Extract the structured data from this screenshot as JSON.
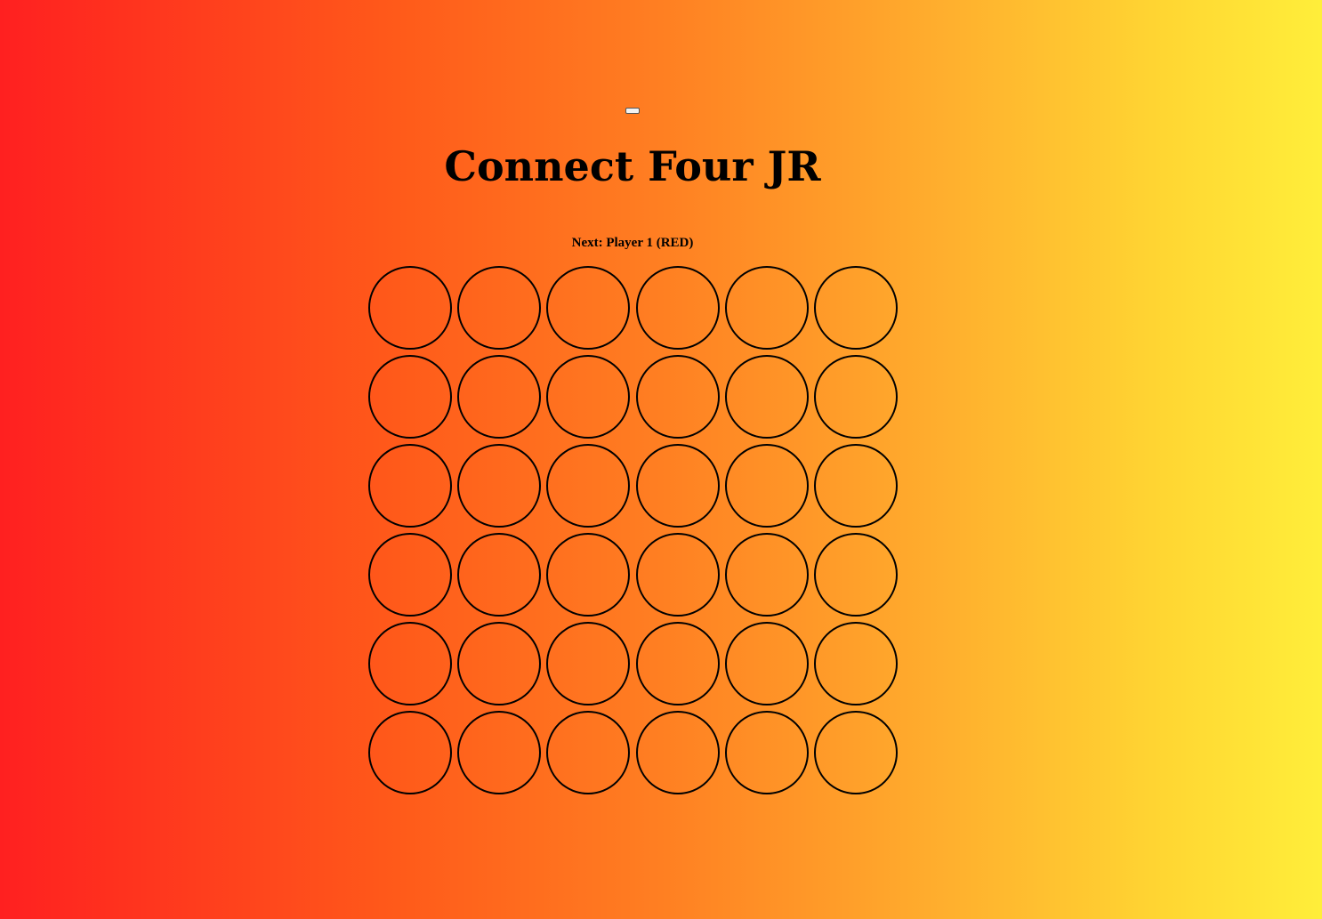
{
  "game": {
    "title": "Connect Four JR",
    "status_text": "Next: Player 1 (RED)",
    "reset_label": ""
  },
  "board": {
    "rows": 6,
    "columns": 6,
    "cells": [
      [
        "empty",
        "empty",
        "empty",
        "empty",
        "empty",
        "empty"
      ],
      [
        "empty",
        "empty",
        "empty",
        "empty",
        "empty",
        "empty"
      ],
      [
        "empty",
        "empty",
        "empty",
        "empty",
        "empty",
        "empty"
      ],
      [
        "empty",
        "empty",
        "empty",
        "empty",
        "empty",
        "empty"
      ],
      [
        "empty",
        "empty",
        "empty",
        "empty",
        "empty",
        "empty"
      ],
      [
        "empty",
        "empty",
        "empty",
        "empty",
        "empty",
        "empty"
      ]
    ]
  },
  "colors": {
    "gradient_start": "#ff2020",
    "gradient_end": "#ffee3a",
    "player1": "#e00000",
    "player2": "#ffe000",
    "cell_border": "#000000"
  }
}
